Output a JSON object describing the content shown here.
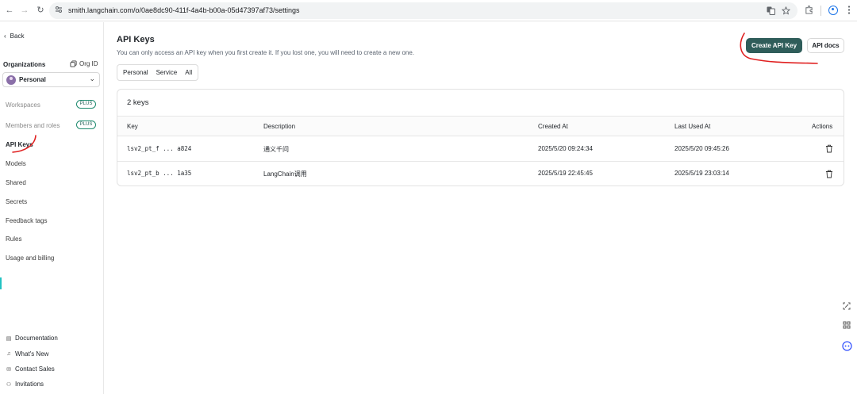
{
  "browser": {
    "url": "smith.langchain.com/o/0ae8dc90-411f-4a4b-b00a-05d47397af73/settings",
    "back_glyph": "←",
    "forward_glyph": "→",
    "reload_glyph": "↻"
  },
  "sidebar": {
    "back_label": "Back",
    "organizations_label": "Organizations",
    "org_id_label": "Org ID",
    "org_name": "Personal",
    "items": [
      {
        "label": "Workspaces",
        "badge": "PLUS"
      },
      {
        "label": "Members and roles",
        "badge": "PLUS"
      },
      {
        "label": "API Keys",
        "badge": ""
      },
      {
        "label": "Models",
        "badge": ""
      },
      {
        "label": "Shared",
        "badge": ""
      },
      {
        "label": "Secrets",
        "badge": ""
      },
      {
        "label": "Feedback tags",
        "badge": ""
      },
      {
        "label": "Rules",
        "badge": ""
      },
      {
        "label": "Usage and billing",
        "badge": ""
      }
    ],
    "footer": [
      {
        "label": "Documentation",
        "icon": "document-icon"
      },
      {
        "label": "What's New",
        "icon": "bell-icon"
      },
      {
        "label": "Contact Sales",
        "icon": "mail-icon"
      },
      {
        "label": "Invitations",
        "icon": "user-icon"
      }
    ]
  },
  "main": {
    "title": "API Keys",
    "subtitle": "You can only access an API key when you first create it. If you lost one, you will need to create a new one.",
    "create_button": "Create API Key",
    "docs_button": "API docs",
    "filters": [
      "Personal",
      "Service",
      "All"
    ],
    "keys_count": "2 keys",
    "columns": [
      "Key",
      "Description",
      "Created At",
      "Last Used At",
      "Actions"
    ],
    "rows": [
      {
        "key": "lsv2_pt_f ... a824",
        "description": "通义千问",
        "created_at": "2025/5/20 09:24:34",
        "last_used_at": "2025/5/20 09:45:26"
      },
      {
        "key": "lsv2_pt_b ... 1a35",
        "description": "LangChain调用",
        "created_at": "2025/5/19 22:45:45",
        "last_used_at": "2025/5/19 23:03:14"
      }
    ]
  },
  "colors": {
    "primary_button": "#2f5d5a",
    "plus_badge_border": "#1f8b6f",
    "annotation_red": "#e02020",
    "side_accent": "#22c2c2"
  }
}
